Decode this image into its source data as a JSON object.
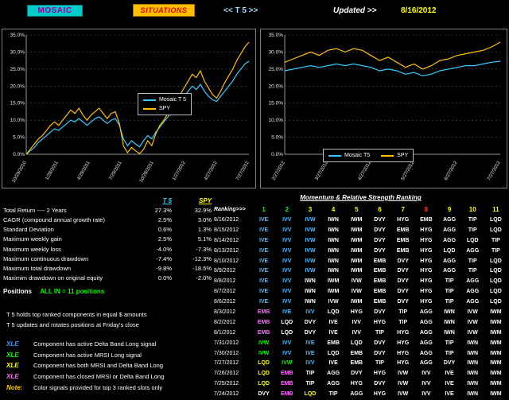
{
  "header": {
    "mosaic_label": "MOSAIC",
    "situations_label": "SITUATIONS",
    "t5_label": "<< T 5 >>",
    "updated_label": "Updated >>",
    "date": "8/16/2012"
  },
  "chart_data": [
    {
      "id": "left",
      "type": "line",
      "title": "Mosaic T5 vs SPY cumulative return - 2 years",
      "ylim": [
        0,
        35
      ],
      "ytick_step": 5,
      "grid": true,
      "legend_position": "middle-right",
      "x_labels": [
        "10/29/2010",
        "1/28/2011",
        "4/29/2011",
        "7/29/2011",
        "10/28/2011",
        "1/27/2012",
        "4/27/2012",
        "7/27/2012"
      ],
      "series": [
        {
          "name": "Mosaic T 5",
          "color": "#33CCFF",
          "values": [
            0.0,
            1.0,
            2.0,
            3.5,
            4.5,
            5.5,
            6.5,
            7.5,
            7.0,
            8.0,
            9.0,
            10.0,
            9.5,
            10.5,
            9.5,
            8.5,
            9.5,
            10.5,
            11.0,
            10.0,
            9.0,
            10.0,
            10.5,
            8.5,
            4.5,
            2.5,
            4.0,
            3.0,
            2.2,
            4.0,
            5.5,
            4.5,
            6.5,
            8.0,
            9.5,
            11.0,
            12.5,
            14.0,
            15.5,
            17.0,
            18.5,
            20.0,
            19.0,
            20.5,
            18.5,
            17.0,
            16.0,
            15.5,
            17.0,
            18.5,
            20.0,
            21.5,
            23.5,
            25.0,
            26.5,
            27.3
          ]
        },
        {
          "name": "SPY",
          "color": "#FFC000",
          "values": [
            0.0,
            1.5,
            3.0,
            4.5,
            5.5,
            7.0,
            8.5,
            9.5,
            8.5,
            10.0,
            11.5,
            13.0,
            12.0,
            13.5,
            11.5,
            10.0,
            11.5,
            12.5,
            13.5,
            12.0,
            10.5,
            12.0,
            12.5,
            9.0,
            2.5,
            0.5,
            2.0,
            1.0,
            0.2,
            1.5,
            4.0,
            2.5,
            6.0,
            8.5,
            10.0,
            12.0,
            14.0,
            15.5,
            17.5,
            19.5,
            21.5,
            23.5,
            22.5,
            24.5,
            21.5,
            19.5,
            17.5,
            16.5,
            18.5,
            21.0,
            23.0,
            25.0,
            27.5,
            29.5,
            31.5,
            32.9
          ]
        }
      ]
    },
    {
      "id": "right",
      "type": "line",
      "title": "Mosaic T5 vs SPY cumulative return - recent months",
      "ylim": [
        0,
        35
      ],
      "ytick_step": 5,
      "grid": true,
      "legend_position": "bottom-center",
      "x_labels": [
        "2/27/2012",
        "3/27/2012",
        "4/27/2012",
        "5/27/2012",
        "6/27/2012",
        "7/27/2012"
      ],
      "series": [
        {
          "name": "Mosaic T5",
          "color": "#33CCFF",
          "values": [
            24.5,
            25.0,
            25.5,
            26.0,
            25.5,
            26.0,
            26.5,
            26.0,
            26.5,
            26.0,
            25.5,
            24.5,
            25.0,
            24.5,
            23.5,
            24.0,
            23.0,
            23.5,
            24.5,
            25.0,
            25.5,
            26.0,
            26.0,
            26.5,
            27.0,
            27.3
          ]
        },
        {
          "name": "SPY",
          "color": "#FFC000",
          "values": [
            27.0,
            28.0,
            29.0,
            30.0,
            29.0,
            30.5,
            31.0,
            30.0,
            31.0,
            30.5,
            29.0,
            27.5,
            28.5,
            27.0,
            25.5,
            26.5,
            25.0,
            26.0,
            27.5,
            28.0,
            29.0,
            29.5,
            30.0,
            30.5,
            31.5,
            32.9
          ]
        }
      ]
    }
  ],
  "stats": {
    "headers": {
      "t5": "T 5",
      "spy": "SPY"
    },
    "rows": [
      {
        "label": "Total Return ---- 2 Years",
        "t5": "27.3%",
        "spy": "32.9%"
      },
      {
        "label": "CAGR (compound annual growth rate)",
        "t5": "2.5%",
        "spy": "3.0%"
      },
      {
        "label": "Standard Deviation",
        "t5": "0.6%",
        "spy": "1.3%"
      },
      {
        "label": "Maximum weekly gain",
        "t5": "2.5%",
        "spy": "5.1%"
      },
      {
        "label": "Maximum weekly loss",
        "t5": "-4.0%",
        "spy": "-7.3%"
      },
      {
        "label": "Maximum continuous drawdown",
        "t5": "-7.4%",
        "spy": "-12.3%"
      },
      {
        "label": "Maximum total drawdown",
        "t5": "-9.8%",
        "spy": "-18.5%"
      },
      {
        "label": "Maximim drawdown on original equity",
        "t5": "0.0%",
        "spy": "-2.0%"
      }
    ],
    "positions_label": "Positions",
    "positions_value": "ALL IN = 11 positions",
    "notes": [
      "T 5 holds top ranked components in equal $ amounts",
      "T 5 updates and rotates positions at Friday's close"
    ],
    "signal_legend": [
      {
        "tag": "XLE",
        "color": "#3399FF",
        "text": "Component has active Delta Band Long signal"
      },
      {
        "tag": "XLE",
        "color": "#00FF00",
        "text": "Component has active MRSI Long signal"
      },
      {
        "tag": "XLE",
        "color": "#FFFF00",
        "text": "Component has both MRSI and Delta Band Long"
      },
      {
        "tag": "XLE",
        "color": "#FF66FF",
        "text": "Component has closed MRSI or Delta Band Long"
      },
      {
        "tag": "Note:",
        "color": "#FFCC00",
        "text": "Color signals provided for top 3 ranked slots only"
      }
    ]
  },
  "ranking": {
    "title": "Momentum & Relative Strength Ranking",
    "header_label": "Ranking>>>",
    "columns": [
      {
        "n": "1",
        "color": "#00FF00"
      },
      {
        "n": "2",
        "color": "#00FF00"
      },
      {
        "n": "3",
        "color": "#FFFF00"
      },
      {
        "n": "4",
        "color": "#FFFF00"
      },
      {
        "n": "5",
        "color": "#FFFF00"
      },
      {
        "n": "6",
        "color": "#FFFF00"
      },
      {
        "n": "7",
        "color": "#FFFF00"
      },
      {
        "n": "8",
        "color": "#FF3333"
      },
      {
        "n": "9",
        "color": "#FFFF00"
      },
      {
        "n": "10",
        "color": "#FFFF00"
      },
      {
        "n": "11",
        "color": "#FFFF00"
      }
    ],
    "cell_colors": {
      "c": "#55BBFF",
      "g": "#00FF00",
      "y": "#FFFF00",
      "m": "#FF66FF",
      "w": "#FFFFFF"
    },
    "rows": [
      {
        "date": "8/16/2012",
        "cells": [
          "c|IVE",
          "c|IVV",
          "c|IVW",
          "w|IWN",
          "w|IWM",
          "w|DVY",
          "w|HYG",
          "w|EMB",
          "w|AGG",
          "w|TIP",
          "w|LQD"
        ]
      },
      {
        "date": "8/15/2012",
        "cells": [
          "c|IVE",
          "c|IVV",
          "c|IVW",
          "w|IWN",
          "w|IWM",
          "w|DVY",
          "w|EMB",
          "w|HYG",
          "w|AGG",
          "w|TIP",
          "w|LQD"
        ]
      },
      {
        "date": "8/14/2012",
        "cells": [
          "c|IVE",
          "c|IVV",
          "c|IVW",
          "w|IWN",
          "w|IWM",
          "w|DVY",
          "w|EMB",
          "w|HYG",
          "w|AGG",
          "w|LQD",
          "w|TIP"
        ]
      },
      {
        "date": "8/13/2012",
        "cells": [
          "c|IVE",
          "c|IVV",
          "c|IVW",
          "w|IWN",
          "w|IWM",
          "w|DVY",
          "w|EMB",
          "w|HYG",
          "w|LQD",
          "w|AGG",
          "w|TIP"
        ]
      },
      {
        "date": "8/10/2012",
        "cells": [
          "c|IVE",
          "c|IVV",
          "c|IVW",
          "w|IWN",
          "w|IWM",
          "w|EMB",
          "w|DVY",
          "w|HYG",
          "w|AGG",
          "w|TIP",
          "w|LQD"
        ]
      },
      {
        "date": "8/9/2012",
        "cells": [
          "c|IVE",
          "c|IVV",
          "c|IVW",
          "w|IWN",
          "w|IWM",
          "w|EMB",
          "w|DVY",
          "w|HYG",
          "w|AGG",
          "w|TIP",
          "w|LQD"
        ]
      },
      {
        "date": "8/8/2012",
        "cells": [
          "c|IVE",
          "c|IVV",
          "w|IWN",
          "w|IWM",
          "w|IVW",
          "w|EMB",
          "w|DVY",
          "w|HYG",
          "w|TIP",
          "w|AGG",
          "w|LQD"
        ]
      },
      {
        "date": "8/7/2012",
        "cells": [
          "c|IVE",
          "c|IVV",
          "w|IWN",
          "w|IWM",
          "w|IVW",
          "w|EMB",
          "w|DVY",
          "w|HYG",
          "w|TIP",
          "w|AGG",
          "w|LQD"
        ]
      },
      {
        "date": "8/6/2012",
        "cells": [
          "c|IVE",
          "c|IVV",
          "w|IWN",
          "w|IVW",
          "w|IWM",
          "w|EMB",
          "w|DVY",
          "w|HYG",
          "w|TIP",
          "w|AGG",
          "w|LQD"
        ]
      },
      {
        "date": "8/3/2012",
        "cells": [
          "m|EMB",
          "c|IVE",
          "c|IVV",
          "w|LQD",
          "w|HYG",
          "w|DVY",
          "w|TIP",
          "w|AGG",
          "w|IWN",
          "w|IVW",
          "w|IWM"
        ]
      },
      {
        "date": "8/2/2012",
        "cells": [
          "m|EMB",
          "w|LQD",
          "w|DVY",
          "w|IVE",
          "w|IVV",
          "w|HYG",
          "w|TIP",
          "w|AGG",
          "w|IWN",
          "w|IVW",
          "w|IWM"
        ]
      },
      {
        "date": "8/1/2012",
        "cells": [
          "m|EMB",
          "w|LQD",
          "w|DVY",
          "w|IVE",
          "w|IVV",
          "w|TIP",
          "w|HYG",
          "w|AGG",
          "w|IWN",
          "w|IVW",
          "w|IWM"
        ]
      },
      {
        "date": "7/31/2012",
        "cells": [
          "g|IVW",
          "c|IVV",
          "c|IVE",
          "w|EMB",
          "w|LQD",
          "w|DVY",
          "w|HYG",
          "w|AGG",
          "w|TIP",
          "w|IWN",
          "w|IWM"
        ]
      },
      {
        "date": "7/30/2012",
        "cells": [
          "g|IVW",
          "c|IVV",
          "c|IVE",
          "w|LQD",
          "w|EMB",
          "w|DVY",
          "w|HYG",
          "w|AGG",
          "w|TIP",
          "w|IWN",
          "w|IWM"
        ]
      },
      {
        "date": "7/27/2012",
        "cells": [
          "y|LQD",
          "g|IVW",
          "c|IVV",
          "w|IVE",
          "w|EMB",
          "w|TIP",
          "w|HYG",
          "w|AGG",
          "w|DVY",
          "w|IWN",
          "w|IWM"
        ]
      },
      {
        "date": "7/26/2012",
        "cells": [
          "y|LQD",
          "m|EMB",
          "w|TIP",
          "w|AGG",
          "w|DVY",
          "w|HYG",
          "w|IVW",
          "w|IVV",
          "w|IVE",
          "w|IWN",
          "w|IWM"
        ]
      },
      {
        "date": "7/25/2012",
        "cells": [
          "y|LQD",
          "m|EMB",
          "w|TIP",
          "w|AGG",
          "w|HYG",
          "w|DVY",
          "w|IVW",
          "w|IVV",
          "w|IVE",
          "w|IWN",
          "w|IWM"
        ]
      },
      {
        "date": "7/24/2012",
        "cells": [
          "w|DVY",
          "m|EMB",
          "y|LQD",
          "w|TIP",
          "w|AGG",
          "w|HYG",
          "w|IVW",
          "w|IVV",
          "w|IVE",
          "w|IWN",
          "w|IWM"
        ]
      }
    ]
  }
}
